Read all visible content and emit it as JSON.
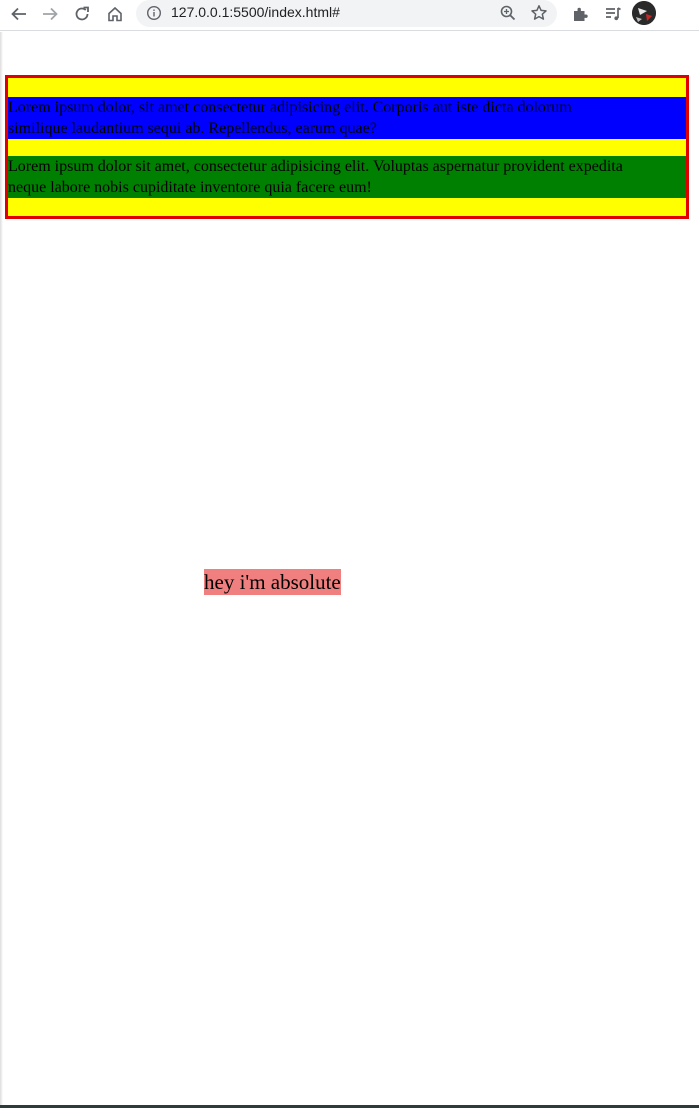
{
  "browser": {
    "url": "127.0.0.1:5500/index.html#",
    "icons": [
      "back-arrow-icon",
      "forward-arrow-icon",
      "reload-icon",
      "home-icon",
      "info-icon",
      "zoom-icon",
      "star-icon",
      "extensions-icon",
      "reading-list-icon",
      "profile-avatar"
    ]
  },
  "page": {
    "paragraphs": [
      "Lorem ipsum dolor, sit amet consectetur adipisicing elit. Corporis aut iste dicta dolorum\nsimilique laudantium sequi ab. Repellendus, earum quae?",
      "Lorem ipsum dolor sit amet, consectetur adipisicing elit. Voluptas aspernatur provident expedita\nneque labore nobis cupiditate inventore quia facere eum!"
    ],
    "absolute_label": "hey i'm absolute"
  },
  "colors": {
    "container_background": "#ffff00",
    "container_border": "#e00000",
    "paragraph_1_background": "#0000ff",
    "paragraph_2_background": "#008000",
    "absolute_label_background": "#f08080"
  }
}
